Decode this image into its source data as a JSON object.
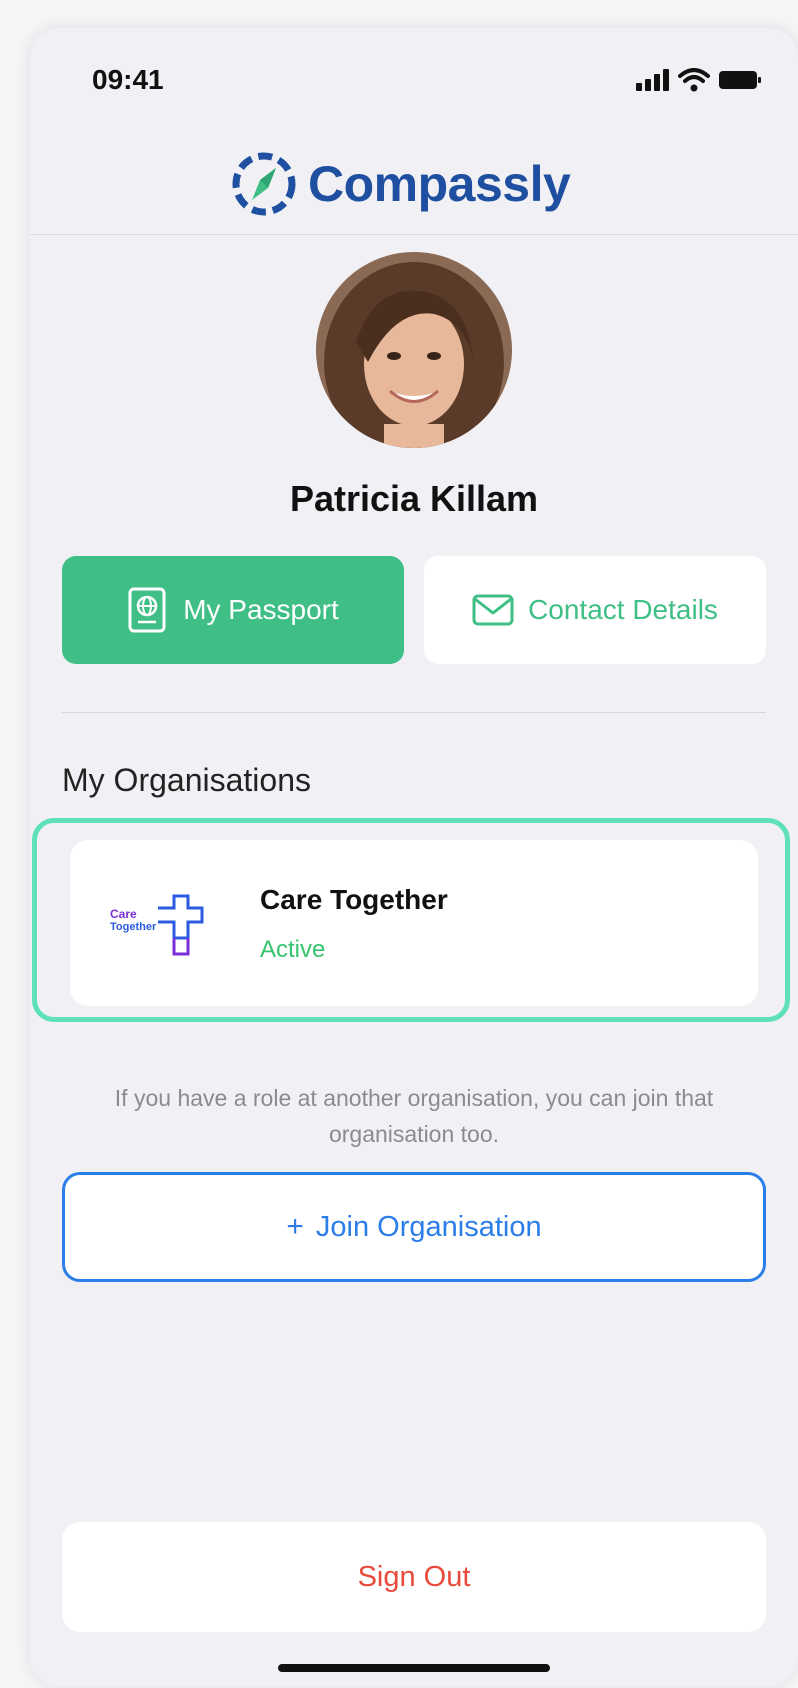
{
  "status_bar": {
    "time": "09:41"
  },
  "header": {
    "app_name": "Compassly",
    "brand_color": "#1f4fa0"
  },
  "profile": {
    "name": "Patricia Killam"
  },
  "actions": {
    "passport_label": "My Passport",
    "contact_label": "Contact Details",
    "accent_color": "#3fbf85"
  },
  "organisations": {
    "section_title": "My Organisations",
    "items": [
      {
        "name": "Care Together",
        "status": "Active",
        "logo_text": [
          "Care",
          "Together"
        ]
      }
    ]
  },
  "info": {
    "text": "If you have a role at another organisation, you can join that organisation too."
  },
  "join": {
    "plus": "+",
    "label": "Join Organisation"
  },
  "signout": {
    "label": "Sign Out"
  }
}
